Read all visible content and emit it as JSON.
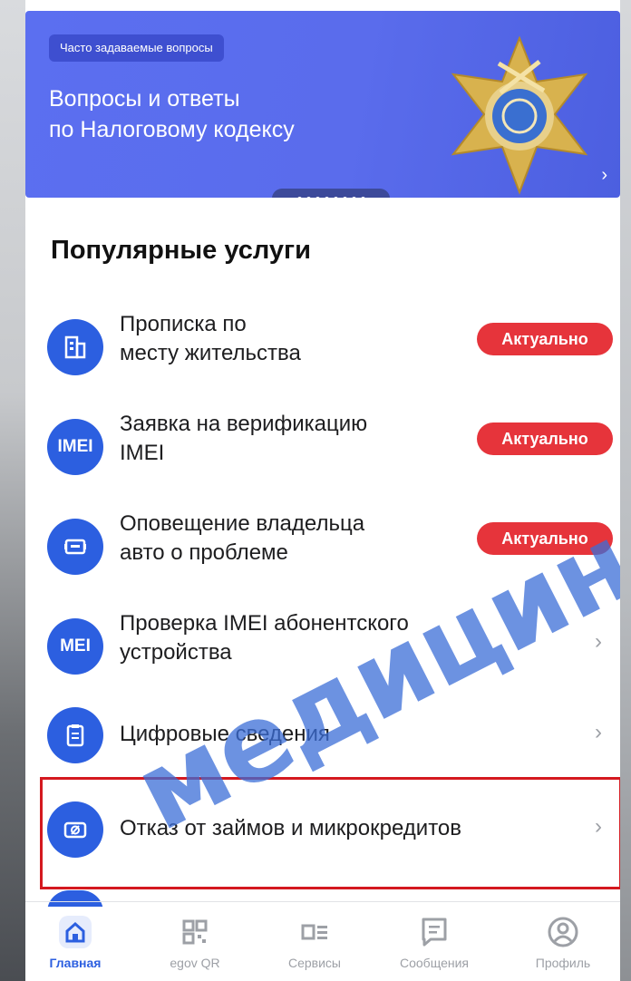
{
  "banner": {
    "badge": "Часто задаваемые вопросы",
    "title_line1": "Вопросы и ответы",
    "title_line2": "по Налоговому кодексу",
    "chevron": "›"
  },
  "section_title": "Популярные услуги",
  "services": [
    {
      "line1": "Прописка по",
      "line2": "месту жительства",
      "badge": "Актуально",
      "icon": "building-icon"
    },
    {
      "line1": "Заявка на верификацию",
      "line2": "IMEI",
      "badge": "Актуально",
      "icon": "imei-icon",
      "icon_text": "IMEI"
    },
    {
      "line1": "Оповещение владельца",
      "line2": "авто о проблеме",
      "badge": "Актуально",
      "icon": "car-icon"
    },
    {
      "line1": "Проверка IMEI абонентского",
      "line2": "устройства",
      "chevron": "›",
      "icon": "imei-search-icon",
      "icon_text": "MEI"
    },
    {
      "line1": "Цифровые сведения",
      "chevron": "›",
      "icon": "clipboard-icon"
    },
    {
      "line1": "Отказ от займов и микрокредитов",
      "chevron": "›",
      "icon": "money-off-icon"
    }
  ],
  "nav": [
    {
      "label": "Главная",
      "icon": "home-icon",
      "active": true
    },
    {
      "label": "egov QR",
      "icon": "qr-icon"
    },
    {
      "label": "Сервисы",
      "icon": "services-icon"
    },
    {
      "label": "Сообщения",
      "icon": "messages-icon"
    },
    {
      "label": "Профиль",
      "icon": "profile-icon"
    }
  ],
  "watermark": "медицин",
  "colors": {
    "accent": "#2c5fe0",
    "badge": "#e6343b",
    "banner": "#5a6cec",
    "highlight": "#d4191f"
  }
}
